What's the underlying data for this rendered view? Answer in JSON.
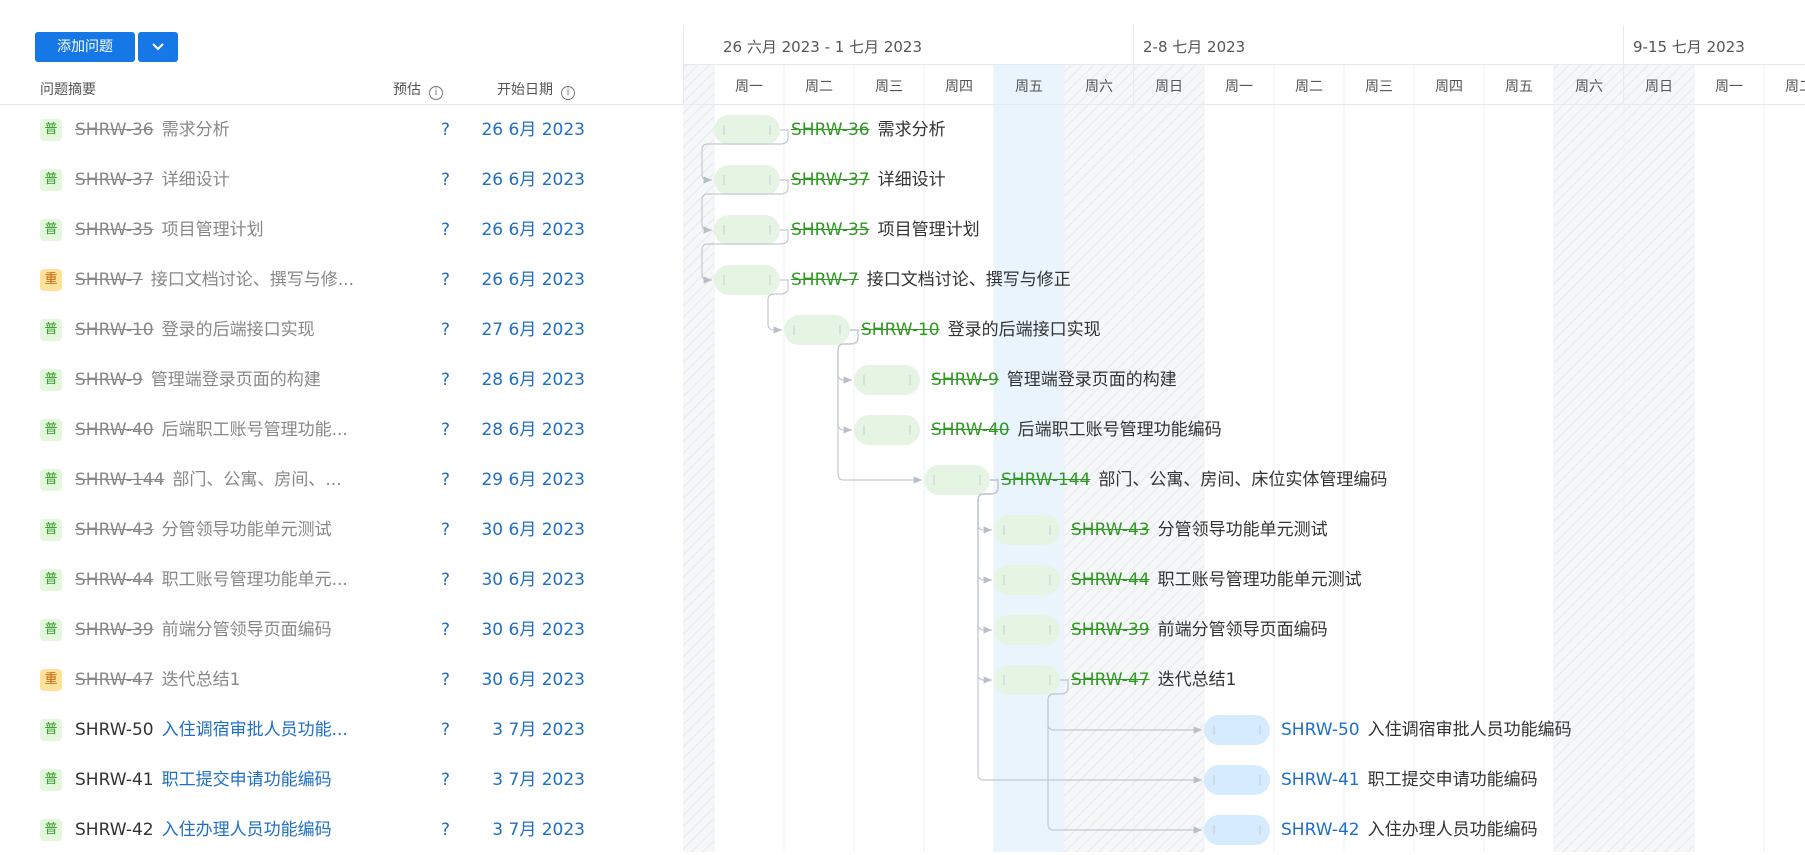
{
  "toolbar": {
    "add_label": "添加问题"
  },
  "columns": {
    "summary": "问题摘要",
    "estimate": "预估",
    "start": "开始日期"
  },
  "weeks": [
    "26 六月 2023 - 1 七月 2023",
    "2-8 七月 2023",
    "9-15 七月 2023"
  ],
  "days": [
    "周一",
    "周二",
    "周三",
    "周四",
    "周五",
    "周六",
    "周日",
    "周一",
    "周二",
    "周三",
    "周四",
    "周五",
    "周六",
    "周日",
    "周一",
    "周二"
  ],
  "colors": {
    "done_bar": "#e6f4e4",
    "open_bar": "#d6ebfd",
    "accent": "#1677e6",
    "today": "#eaf4fd"
  },
  "rows": [
    {
      "badge": "普",
      "priority": "n",
      "key": "SHRW-36",
      "title": "需求分析",
      "full": "需求分析",
      "est": "?",
      "date": "26 6月 2023",
      "done": true,
      "col": 0
    },
    {
      "badge": "普",
      "priority": "n",
      "key": "SHRW-37",
      "title": "详细设计",
      "full": "详细设计",
      "est": "?",
      "date": "26 6月 2023",
      "done": true,
      "col": 0
    },
    {
      "badge": "普",
      "priority": "n",
      "key": "SHRW-35",
      "title": "项目管理计划",
      "full": "项目管理计划",
      "est": "?",
      "date": "26 6月 2023",
      "done": true,
      "col": 0
    },
    {
      "badge": "重",
      "priority": "z",
      "key": "SHRW-7",
      "title": "接口文档讨论、撰写与修...",
      "full": "接口文档讨论、撰写与修正",
      "est": "?",
      "date": "26 6月 2023",
      "done": true,
      "col": 0
    },
    {
      "badge": "普",
      "priority": "n",
      "key": "SHRW-10",
      "title": "登录的后端接口实现",
      "full": "登录的后端接口实现",
      "est": "?",
      "date": "27 6月 2023",
      "done": true,
      "col": 1
    },
    {
      "badge": "普",
      "priority": "n",
      "key": "SHRW-9",
      "title": "管理端登录页面的构建",
      "full": "管理端登录页面的构建",
      "est": "?",
      "date": "28 6月 2023",
      "done": true,
      "col": 2
    },
    {
      "badge": "普",
      "priority": "n",
      "key": "SHRW-40",
      "title": "后端职工账号管理功能...",
      "full": "后端职工账号管理功能编码",
      "est": "?",
      "date": "28 6月 2023",
      "done": true,
      "col": 2
    },
    {
      "badge": "普",
      "priority": "n",
      "key": "SHRW-144",
      "title": "部门、公寓、房间、...",
      "full": "部门、公寓、房间、床位实体管理编码",
      "est": "?",
      "date": "29 6月 2023",
      "done": true,
      "col": 3
    },
    {
      "badge": "普",
      "priority": "n",
      "key": "SHRW-43",
      "title": "分管领导功能单元测试",
      "full": "分管领导功能单元测试",
      "est": "?",
      "date": "30 6月 2023",
      "done": true,
      "col": 4
    },
    {
      "badge": "普",
      "priority": "n",
      "key": "SHRW-44",
      "title": "职工账号管理功能单元...",
      "full": "职工账号管理功能单元测试",
      "est": "?",
      "date": "30 6月 2023",
      "done": true,
      "col": 4
    },
    {
      "badge": "普",
      "priority": "n",
      "key": "SHRW-39",
      "title": "前端分管领导页面编码",
      "full": "前端分管领导页面编码",
      "est": "?",
      "date": "30 6月 2023",
      "done": true,
      "col": 4
    },
    {
      "badge": "重",
      "priority": "z",
      "key": "SHRW-47",
      "title": "迭代总结1",
      "full": "迭代总结1",
      "est": "?",
      "date": "30 6月 2023",
      "done": true,
      "col": 4
    },
    {
      "badge": "普",
      "priority": "n",
      "key": "SHRW-50",
      "title": "入住调宿审批人员功能...",
      "full": "入住调宿审批人员功能编码",
      "est": "?",
      "date": "3 7月 2023",
      "done": false,
      "col": 7
    },
    {
      "badge": "普",
      "priority": "n",
      "key": "SHRW-41",
      "title": "职工提交申请功能编码",
      "full": "职工提交申请功能编码",
      "est": "?",
      "date": "3 7月 2023",
      "done": false,
      "col": 7
    },
    {
      "badge": "普",
      "priority": "n",
      "key": "SHRW-42",
      "title": "入住办理人员功能编码",
      "full": "入住办理人员功能编码",
      "est": "?",
      "date": "3 7月 2023",
      "done": false,
      "col": 7
    }
  ]
}
